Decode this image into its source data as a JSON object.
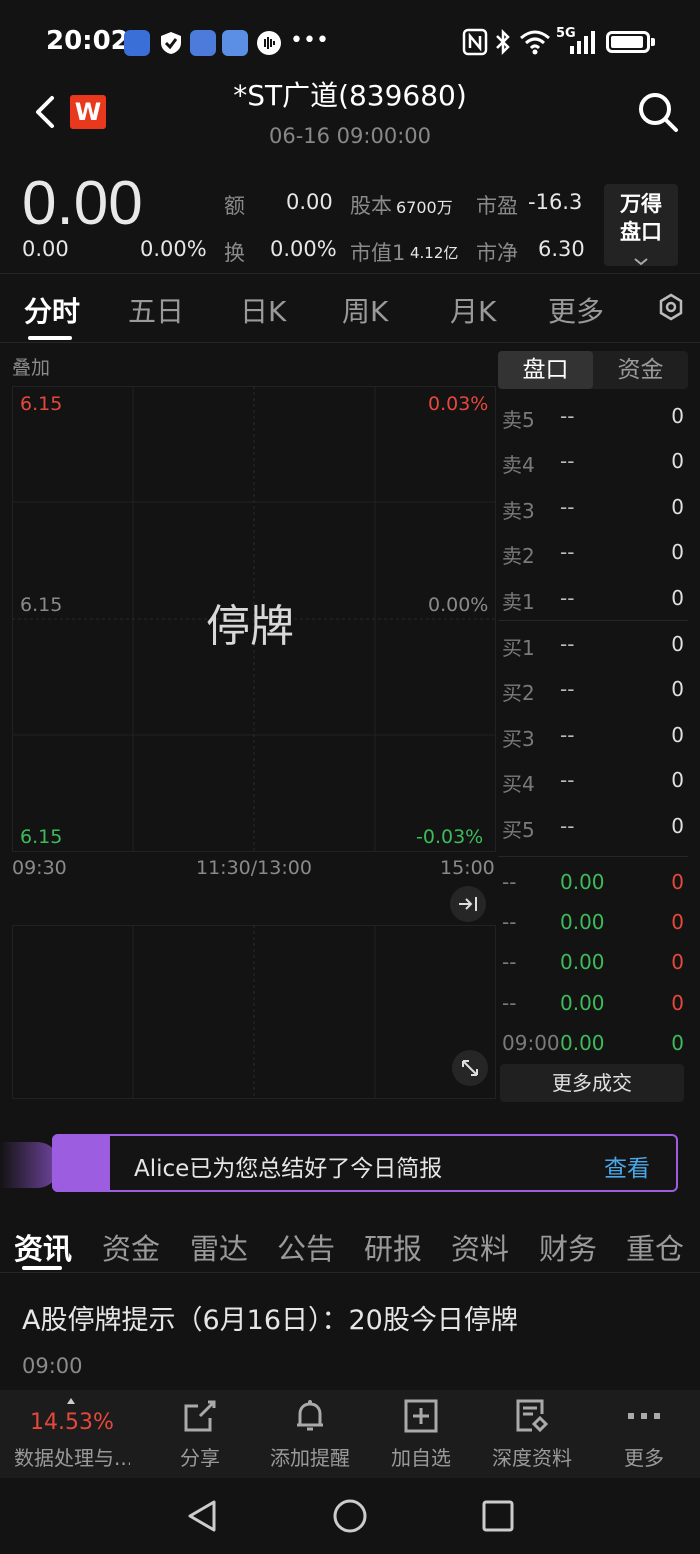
{
  "status_bar": {
    "time": "20:02",
    "network": "5G"
  },
  "header": {
    "logo_letter": "W",
    "title": "*ST广道(839680)",
    "datetime": "06-16 09:00:00"
  },
  "quote": {
    "price": "0.00",
    "change": "0.00",
    "change_pct": "0.00%",
    "amount_label": "额",
    "amount": "0.00",
    "turnover_label": "换",
    "turnover": "0.00%",
    "share_cap_label": "股本",
    "share_cap": "6700万",
    "mkt_value_label": "市值1",
    "mkt_value": "4.12亿",
    "pe_label": "市盈",
    "pe": "-16.3",
    "pb_label": "市净",
    "pb": "6.30",
    "wande_line1": "万得",
    "wande_line2": "盘口"
  },
  "chart_tabs": [
    "分时",
    "五日",
    "日K",
    "周K",
    "月K",
    "更多"
  ],
  "chart": {
    "overlay_label": "叠加",
    "y_top": "6.15",
    "y_mid": "6.15",
    "y_bottom": "6.15",
    "pct_top": "0.03%",
    "pct_mid": "0.00%",
    "pct_bottom": "-0.03%",
    "x_start": "09:30",
    "x_mid": "11:30/13:00",
    "x_end": "15:00",
    "status": "停牌"
  },
  "order_book": {
    "tabs": [
      "盘口",
      "资金"
    ],
    "asks": [
      {
        "label": "卖5",
        "price": "--",
        "vol": "0"
      },
      {
        "label": "卖4",
        "price": "--",
        "vol": "0"
      },
      {
        "label": "卖3",
        "price": "--",
        "vol": "0"
      },
      {
        "label": "卖2",
        "price": "--",
        "vol": "0"
      },
      {
        "label": "卖1",
        "price": "--",
        "vol": "0"
      }
    ],
    "bids": [
      {
        "label": "买1",
        "price": "--",
        "vol": "0"
      },
      {
        "label": "买2",
        "price": "--",
        "vol": "0"
      },
      {
        "label": "买3",
        "price": "--",
        "vol": "0"
      },
      {
        "label": "买4",
        "price": "--",
        "vol": "0"
      },
      {
        "label": "买5",
        "price": "--",
        "vol": "0"
      }
    ],
    "trades": [
      {
        "time": "--",
        "price": "0.00",
        "vol": "0"
      },
      {
        "time": "--",
        "price": "0.00",
        "vol": "0"
      },
      {
        "time": "--",
        "price": "0.00",
        "vol": "0"
      },
      {
        "time": "--",
        "price": "0.00",
        "vol": "0"
      },
      {
        "time": "09:00",
        "price": "0.00",
        "vol": "0"
      }
    ],
    "more_label": "更多成交"
  },
  "banner": {
    "text": "Alice已为您总结好了今日简报",
    "action": "查看"
  },
  "news_tabs": [
    "资讯",
    "资金",
    "雷达",
    "公告",
    "研报",
    "资料",
    "财务",
    "重仓"
  ],
  "news": [
    {
      "title": "A股停牌提示（6月16日）：20股今日停牌",
      "time": "09:00"
    }
  ],
  "toolbar": {
    "sector_pct": "14.53%",
    "sector_label": "数据处理与...",
    "share": "分享",
    "alert": "添加提醒",
    "watch": "加自选",
    "deep": "深度资料",
    "more": "更多"
  },
  "colors": {
    "up": "#e5483b",
    "down": "#3dbb5a",
    "accent": "#9c5de0",
    "link": "#4aa8e8"
  }
}
